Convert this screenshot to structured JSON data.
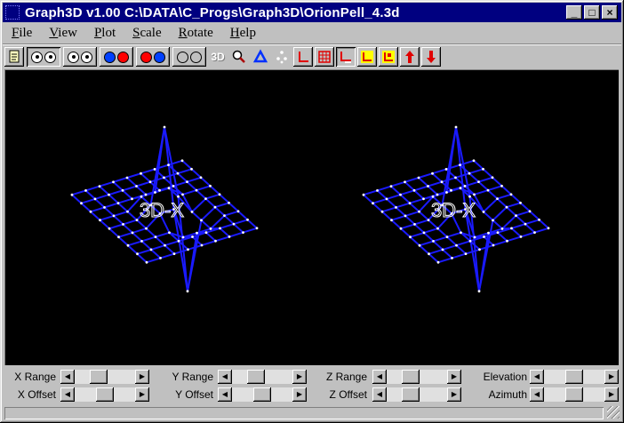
{
  "window": {
    "title": "Graph3D v1.00  C:\\DATA\\C_Progs\\Graph3D\\OrionPell_4.3d",
    "minimize_glyph": "_",
    "maximize_glyph": "□",
    "close_glyph": "×"
  },
  "menubar": {
    "items": [
      {
        "pre": "",
        "u": "F",
        "post": "ile"
      },
      {
        "pre": "",
        "u": "V",
        "post": "iew"
      },
      {
        "pre": "",
        "u": "P",
        "post": "lot"
      },
      {
        "pre": "",
        "u": "S",
        "post": "cale"
      },
      {
        "pre": "",
        "u": "R",
        "post": "otate"
      },
      {
        "pre": "",
        "u": "H",
        "post": "elp"
      }
    ]
  },
  "toolbar": {
    "label_3d": "3D",
    "icons": [
      "new-file-icon",
      "view-mono-icon",
      "view-parallel-icon",
      "view-red-blue-icon",
      "view-red-red-icon",
      "view-grey-icon",
      "3d-text-icon",
      "zoom-icon",
      "triangle-icon",
      "points-icon",
      "axes-icon",
      "grid-box-icon",
      "axes-labels-icon",
      "x-scale-icon",
      "z-scale-icon",
      "up-arrow-icon",
      "down-arrow-icon"
    ]
  },
  "plot": {
    "overlay_text": "3D-X",
    "colors": {
      "mesh": "#1a1aff",
      "nodes": "#ffffff",
      "background": "#000000"
    }
  },
  "controls": {
    "rows": [
      [
        {
          "label": "X Range",
          "level": 0.35
        },
        {
          "label": "Y Range",
          "level": 0.35
        },
        {
          "label": "Z Range",
          "level": 0.35
        },
        {
          "label": "Elevation",
          "level": 0.5
        }
      ],
      [
        {
          "label": "X Offset",
          "level": 0.5
        },
        {
          "label": "Y Offset",
          "level": 0.5
        },
        {
          "label": "Z Offset",
          "level": 0.35
        },
        {
          "label": "Azimuth",
          "level": 0.5
        }
      ]
    ],
    "left_glyph": "◀",
    "right_glyph": "▶"
  }
}
